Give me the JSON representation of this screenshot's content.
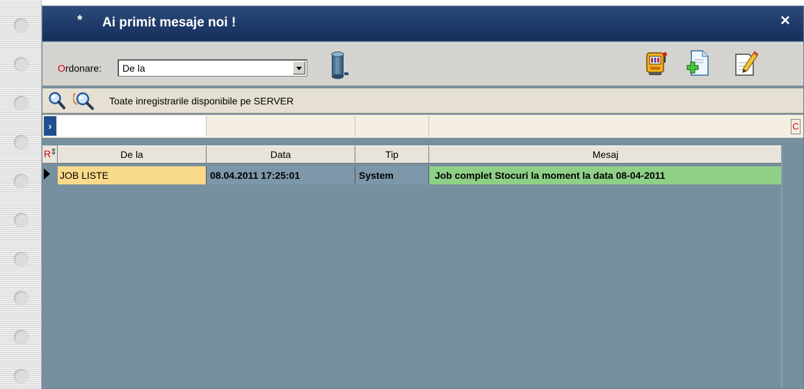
{
  "window": {
    "title_marker": "*",
    "title": "Ai primit mesaje noi !",
    "close_glyph": "×"
  },
  "toolbar": {
    "order_label_first": "O",
    "order_label_rest": "rdonare:",
    "order_value": "De la",
    "icons": [
      "database-icon",
      "slot-machine-icon",
      "new-document-icon",
      "edit-document-icon"
    ]
  },
  "search": {
    "text": "Toate inregistrarile disponibile pe SERVER",
    "icons": [
      "search-icon",
      "search-advanced-icon"
    ]
  },
  "filter": {
    "arrow": "›",
    "clear_label": "C"
  },
  "grid": {
    "row_marker": "R",
    "sort_glyph": "⇕",
    "columns": [
      "De la",
      "Data",
      "Tip",
      "Mesaj"
    ],
    "rows": [
      {
        "de_la": "JOB LISTE",
        "data": "08.04.2011 17:25:01",
        "tip": "System",
        "mesaj": "Job complet Stocuri  la moment la data 08-04-2011"
      }
    ]
  },
  "colors": {
    "titlebar": "#1e3a68",
    "grid_background": "#77909f",
    "from_cell": "#f9d98a",
    "message_cell": "#8fd087"
  }
}
